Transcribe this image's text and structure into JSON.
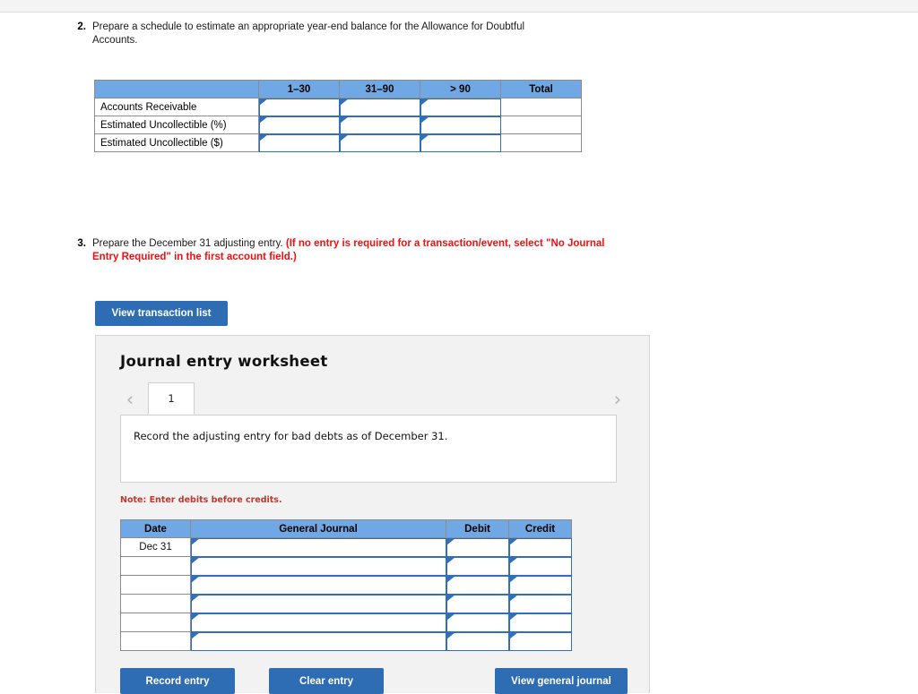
{
  "questions": [
    {
      "number": "2.",
      "text": "Prepare a schedule to estimate an appropriate year-end balance for the Allowance for Doubtful Accounts."
    },
    {
      "number": "3.",
      "text_plain": "Prepare the December 31 adjusting entry. ",
      "text_red": "(If no entry is required for a transaction/event, select \"No Journal Entry Required\" in the first account field.)"
    }
  ],
  "aging_table": {
    "headers": [
      "",
      "1–30",
      "31–90",
      "> 90",
      "Total"
    ],
    "rows": [
      {
        "label": "Accounts Receivable",
        "cells": [
          "",
          "",
          ""
        ],
        "total": ""
      },
      {
        "label": "Estimated Uncollectible (%)",
        "cells": [
          "",
          "",
          ""
        ],
        "total": ""
      },
      {
        "label": "Estimated Uncollectible ($)",
        "cells": [
          "",
          "",
          ""
        ],
        "total": ""
      }
    ]
  },
  "buttons": {
    "view_transaction_list": "View transaction list",
    "record_entry": "Record entry",
    "clear_entry": "Clear entry",
    "view_general_journal": "View general journal"
  },
  "worksheet": {
    "title": "Journal entry worksheet",
    "prev_icon": "‹",
    "next_icon": "›",
    "tabs": [
      {
        "label": "1",
        "active": true
      }
    ],
    "description": "Record the adjusting entry for bad debts as of December 31.",
    "note": "Note: Enter debits before credits.",
    "journal_headers": [
      "Date",
      "General Journal",
      "Debit",
      "Credit"
    ],
    "journal_rows": [
      {
        "date": "Dec 31",
        "account": "",
        "debit": "",
        "credit": ""
      },
      {
        "date": "",
        "account": "",
        "debit": "",
        "credit": ""
      },
      {
        "date": "",
        "account": "",
        "debit": "",
        "credit": ""
      },
      {
        "date": "",
        "account": "",
        "debit": "",
        "credit": ""
      },
      {
        "date": "",
        "account": "",
        "debit": "",
        "credit": ""
      },
      {
        "date": "",
        "account": "",
        "debit": "",
        "credit": ""
      }
    ]
  },
  "colors": {
    "button_blue": "#2e6db4",
    "table_header_blue": "#6fa8e4",
    "input_border_blue": "#2f6fbb",
    "note_red": "#c0392b",
    "instruction_red": "#ee1111",
    "panel_gray": "#f2f2f2"
  }
}
